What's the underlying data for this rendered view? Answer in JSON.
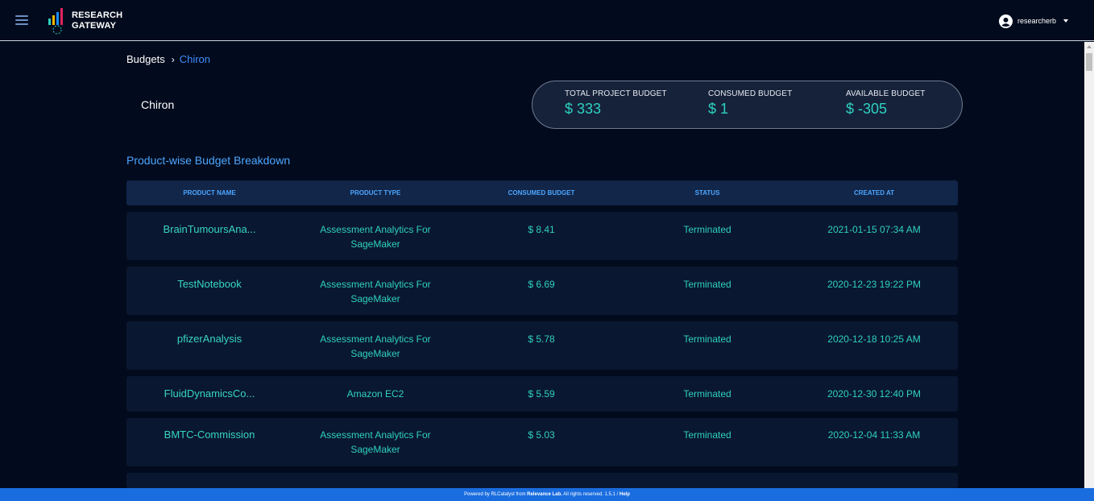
{
  "app": {
    "logo_line1": "RESEARCH",
    "logo_line2": "GATEWAY",
    "username": "researcherb"
  },
  "breadcrumb": {
    "root": "Budgets",
    "current": "Chiron"
  },
  "project": {
    "name": "Chiron"
  },
  "budget": {
    "total_label": "TOTAL PROJECT BUDGET",
    "total_value": "$ 333",
    "consumed_label": "CONSUMED BUDGET",
    "consumed_value": "$ 1",
    "available_label": "AVAILABLE BUDGET",
    "available_value": "$ -305"
  },
  "section": {
    "title": "Product-wise Budget Breakdown"
  },
  "table": {
    "headers": [
      "PRODUCT NAME",
      "PRODUCT TYPE",
      "CONSUMED BUDGET",
      "STATUS",
      "CREATED AT"
    ],
    "rows": [
      {
        "name": "BrainTumoursAna...",
        "type1": "Assessment Analytics For",
        "type2": "SageMaker",
        "budget": "$ 8.41",
        "status": "Terminated",
        "created": "2021-01-15 07:34 AM"
      },
      {
        "name": "TestNotebook",
        "type1": "Assessment Analytics For",
        "type2": "SageMaker",
        "budget": "$ 6.69",
        "status": "Terminated",
        "created": "2020-12-23 19:22 PM"
      },
      {
        "name": "pfizerAnalysis",
        "type1": "Assessment Analytics For",
        "type2": "SageMaker",
        "budget": "$ 5.78",
        "status": "Terminated",
        "created": "2020-12-18 10:25 AM"
      },
      {
        "name": "FluidDynamicsCo...",
        "type1": "Amazon EC2",
        "type2": "",
        "budget": "$ 5.59",
        "status": "Terminated",
        "created": "2020-12-30 12:40 PM"
      },
      {
        "name": "BMTC-Commission",
        "type1": "Assessment Analytics For",
        "type2": "SageMaker",
        "budget": "$ 5.03",
        "status": "Terminated",
        "created": "2020-12-04 11:33 AM"
      }
    ]
  },
  "footer": {
    "text": "Powered by RLCatalyst from ",
    "company": "Relevance Lab.",
    "rest": " All rights reserved. 1.5.1 / ",
    "help": "Help"
  },
  "colors": {
    "accent": "#2ed1c0",
    "link": "#3f8cff",
    "footer": "#1a6ddf",
    "background": "#020b1d"
  }
}
